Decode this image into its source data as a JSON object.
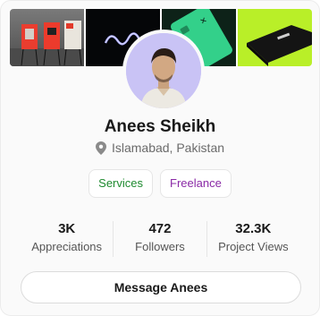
{
  "profile": {
    "name": "Anees Sheikh",
    "location": "Islamabad, Pakistan"
  },
  "tags": {
    "services": "Services",
    "freelance": "Freelance"
  },
  "stats": {
    "appreciations_value": "3K",
    "appreciations_label": "Appreciations",
    "followers_value": "472",
    "followers_label": "Followers",
    "views_value": "32.3K",
    "views_label": "Project Views"
  },
  "actions": {
    "message_label": "Message Anees"
  },
  "colors": {
    "services": "#1e8a2f",
    "freelance": "#8a2aa6",
    "avatar_bg": "#c9c3f5",
    "lime_cover": "#b9ef28"
  }
}
